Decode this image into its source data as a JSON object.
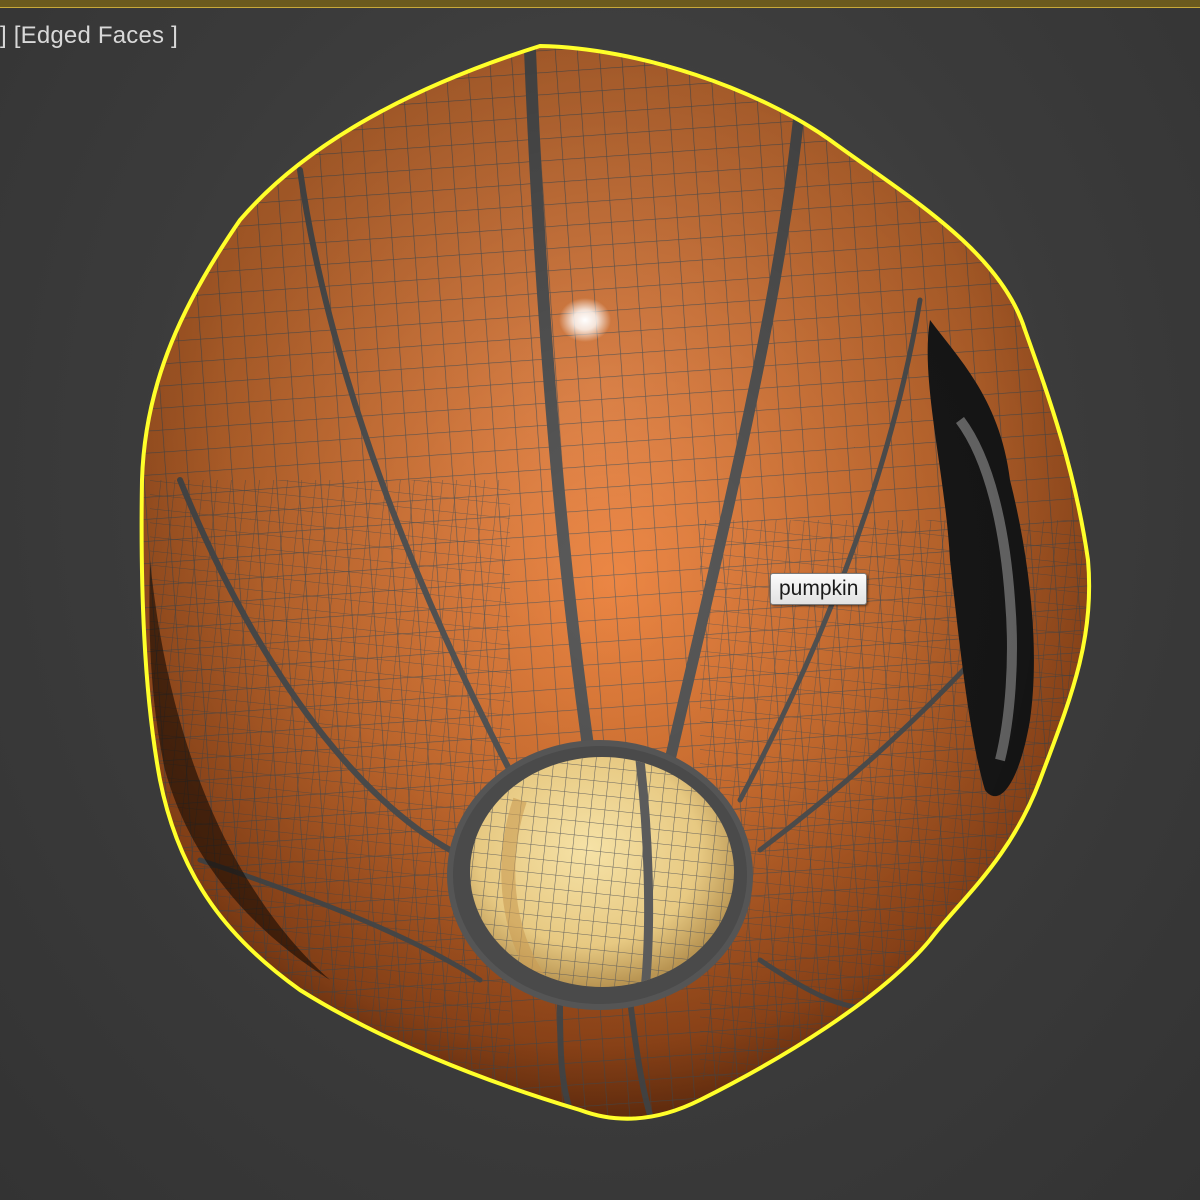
{
  "viewport": {
    "label_prefix": "] ",
    "shading_mode_label": "[Edged Faces ]",
    "selected_object_tooltip": "pumpkin"
  },
  "object": {
    "name": "pumpkin",
    "selected": true
  },
  "colors": {
    "viewport_background": "#3b3b3b",
    "active_viewport_border": "#c8a93a",
    "selection_outline": "#ffff2a",
    "pumpkin_skin": "#e27a35",
    "pumpkin_inner": "#ecd08a",
    "wire_edges": "#5c5c5c"
  }
}
